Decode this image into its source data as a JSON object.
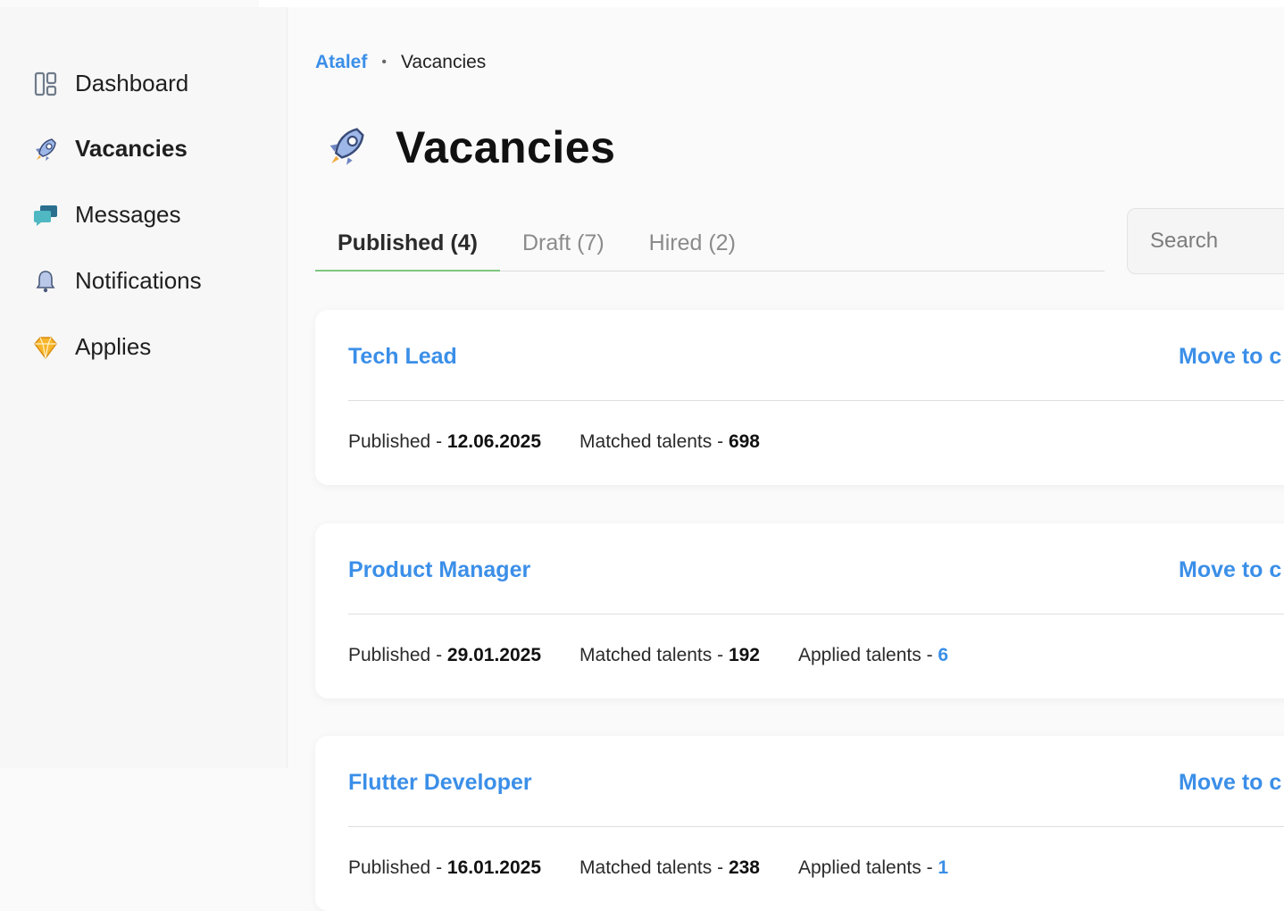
{
  "sidebar": {
    "items": [
      {
        "label": "Dashboard",
        "icon": "dashboard-icon"
      },
      {
        "label": "Vacancies",
        "icon": "rocket-icon",
        "active": true
      },
      {
        "label": "Messages",
        "icon": "chat-bubbles-icon"
      },
      {
        "label": "Notifications",
        "icon": "bell-icon"
      },
      {
        "label": "Applies",
        "icon": "diamond-icon"
      }
    ]
  },
  "breadcrumb": {
    "root": "Atalef",
    "separator": "•",
    "current": "Vacancies"
  },
  "page": {
    "title": "Vacancies",
    "icon": "rocket-icon"
  },
  "tabs": [
    {
      "label": "Published (4)",
      "active": true
    },
    {
      "label": "Draft (7)"
    },
    {
      "label": "Hired (2)"
    }
  ],
  "search": {
    "placeholder": "Search"
  },
  "vacancies": [
    {
      "title": "Tech Lead",
      "action": "Move to c",
      "published_label": "Published - ",
      "published": "12.06.2025",
      "matched_label": "Matched talents - ",
      "matched": "698"
    },
    {
      "title": "Product Manager",
      "action": "Move to c",
      "published_label": "Published - ",
      "published": "29.01.2025",
      "matched_label": "Matched talents - ",
      "matched": "192",
      "applied_label": "Applied talents - ",
      "applied": "6"
    },
    {
      "title": "Flutter Developer",
      "action": "Move to c",
      "published_label": "Published - ",
      "published": "16.01.2025",
      "matched_label": "Matched talents - ",
      "matched": "238",
      "applied_label": "Applied talents - ",
      "applied": "1"
    }
  ],
  "colors": {
    "accent": "#3b8fe8",
    "tab_underline": "#7fc77f"
  }
}
